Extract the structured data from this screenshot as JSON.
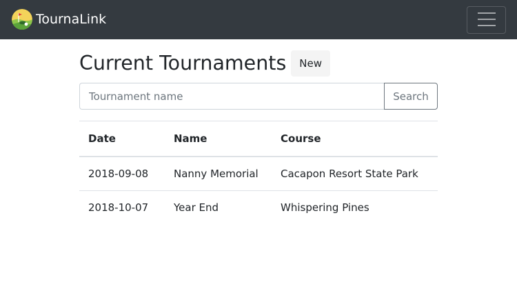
{
  "navbar": {
    "brand": "TournaLink",
    "logo_icon": "golf-course-logo-icon",
    "menu_icon": "hamburger-menu-icon",
    "background": "#343a40"
  },
  "main": {
    "title": "Current Tournaments",
    "new_button": "New",
    "search": {
      "placeholder": "Tournament name",
      "value": "",
      "button": "Search"
    },
    "table": {
      "headers": [
        "Date",
        "Name",
        "Course"
      ],
      "rows": [
        [
          "2018-09-08",
          "Nanny Memorial",
          "Cacapon Resort State Park"
        ],
        [
          "2018-10-07",
          "Year End",
          "Whispering Pines"
        ]
      ]
    }
  }
}
